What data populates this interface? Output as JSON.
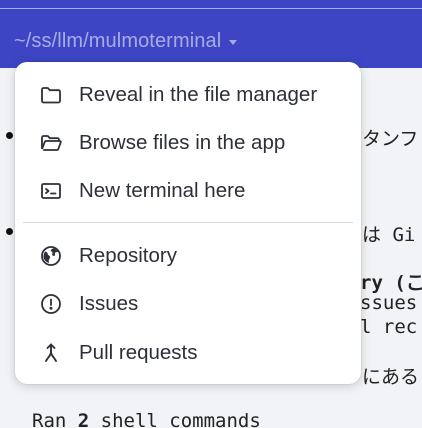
{
  "header": {
    "path_label": "~/ss/llm/mulmoterminal"
  },
  "background": {
    "line1": "タンフ",
    "line2": "は Gi",
    "line3": "ry (こ",
    "line4": "ssues",
    "line5": "l rec",
    "line6": "にある",
    "ran_prefix": "Ran ",
    "ran_count": "2",
    "ran_suffix": " shell commands"
  },
  "menu": {
    "items": [
      {
        "label": "Reveal in the file manager",
        "icon": "folder-icon"
      },
      {
        "label": "Browse files in the app",
        "icon": "folder-open-icon"
      },
      {
        "label": "New terminal here",
        "icon": "terminal-icon"
      },
      {
        "label": "Repository",
        "icon": "globe-icon"
      },
      {
        "label": "Issues",
        "icon": "alert-circle-icon"
      },
      {
        "label": "Pull requests",
        "icon": "merge-icon"
      }
    ]
  },
  "colors": {
    "topbar": "#3d45c4",
    "menu_bg": "#ffffff",
    "text": "#2c3038"
  }
}
